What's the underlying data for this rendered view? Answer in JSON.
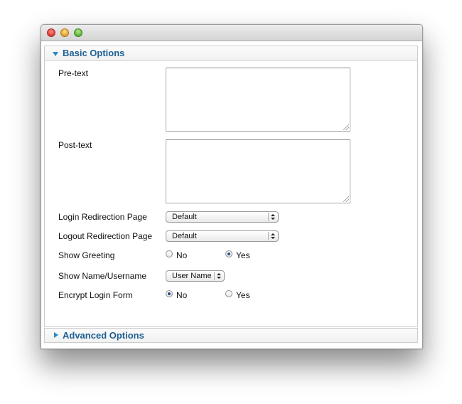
{
  "basic_options": {
    "title": "Basic Options",
    "pre_text": {
      "label": "Pre-text",
      "value": ""
    },
    "post_text": {
      "label": "Post-text",
      "value": ""
    },
    "login_redirection": {
      "label": "Login Redirection Page",
      "value": "Default"
    },
    "logout_redirection": {
      "label": "Logout Redirection Page",
      "value": "Default"
    },
    "show_greeting": {
      "label": "Show Greeting",
      "options": [
        "No",
        "Yes"
      ],
      "selected": "Yes"
    },
    "show_name": {
      "label": "Show Name/Username",
      "value": "User Name"
    },
    "encrypt_login": {
      "label": "Encrypt Login Form",
      "options": [
        "No",
        "Yes"
      ],
      "selected": "No"
    }
  },
  "advanced_options": {
    "title": "Advanced Options"
  },
  "colors": {
    "accent": "#1c5f92",
    "arrow": "#2b89c1"
  },
  "icons": {
    "window_controls": [
      "close-icon",
      "minimize-icon",
      "maximize-icon"
    ],
    "panel_expanded": "triangle-down-icon",
    "panel_collapsed": "triangle-right-icon"
  }
}
